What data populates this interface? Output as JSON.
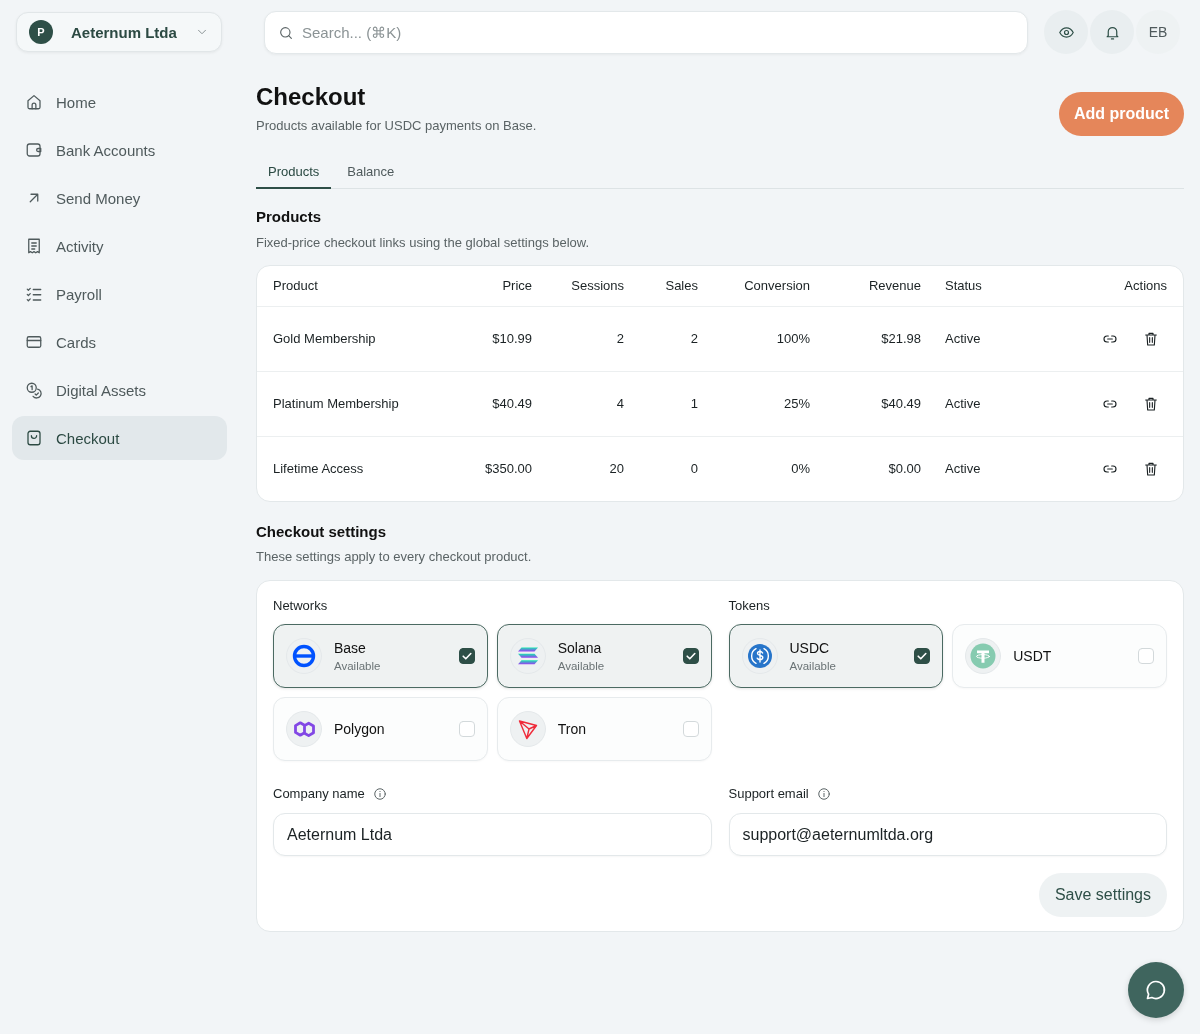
{
  "org_switcher": {
    "initial": "P",
    "name": "Aeternum Ltda"
  },
  "sidebar": {
    "items": [
      {
        "label": "Home",
        "selected": false
      },
      {
        "label": "Bank Accounts",
        "selected": false
      },
      {
        "label": "Send Money",
        "selected": false
      },
      {
        "label": "Activity",
        "selected": false
      },
      {
        "label": "Payroll",
        "selected": false
      },
      {
        "label": "Cards",
        "selected": false
      },
      {
        "label": "Digital Assets",
        "selected": false
      },
      {
        "label": "Checkout",
        "selected": true
      }
    ]
  },
  "top_bar": {
    "search": {
      "placeholder": "Search... (⌘K)"
    },
    "avatar_initials": "EB"
  },
  "page": {
    "title": "Checkout",
    "subtitle": "Products available for USDC payments on Base.",
    "add_button": "Add product"
  },
  "tabs": [
    {
      "label": "Products",
      "selected": true
    },
    {
      "label": "Balance",
      "selected": false
    }
  ],
  "products": {
    "title": "Products",
    "subtitle": "Fixed-price checkout links using the global settings below.",
    "table": {
      "columns": [
        "Product",
        "Price",
        "Sessions",
        "Sales",
        "Conversion",
        "Revenue",
        "Status",
        "Actions"
      ],
      "rows": [
        {
          "cells": [
            "Gold Membership",
            "$10.99",
            "2",
            "2",
            "100%",
            "$21.98",
            "Active"
          ]
        },
        {
          "cells": [
            "Platinum Membership",
            "$40.49",
            "4",
            "1",
            "25%",
            "$40.49",
            "Active"
          ]
        },
        {
          "cells": [
            "Lifetime Access",
            "$350.00",
            "20",
            "0",
            "0%",
            "$0.00",
            "Active"
          ]
        }
      ]
    }
  },
  "settings": {
    "title": "Checkout settings",
    "subtitle": "These settings apply to every checkout product.",
    "networks": {
      "label": "Networks",
      "options": [
        {
          "name": "Base",
          "status": "Available",
          "checked": true
        },
        {
          "name": "Solana",
          "status": "Available",
          "checked": true
        },
        {
          "name": "Polygon",
          "checked": false
        },
        {
          "name": "Tron",
          "checked": false
        }
      ]
    },
    "tokens": {
      "label": "Tokens",
      "options": [
        {
          "name": "USDC",
          "status": "Available",
          "checked": true
        },
        {
          "name": "USDT",
          "checked": false
        }
      ]
    },
    "fields": [
      {
        "label": "Company name",
        "value": "Aeternum Ltda"
      },
      {
        "label": "Support email",
        "value": "support@aeternumltda.org"
      }
    ],
    "save_button": "Save settings"
  }
}
